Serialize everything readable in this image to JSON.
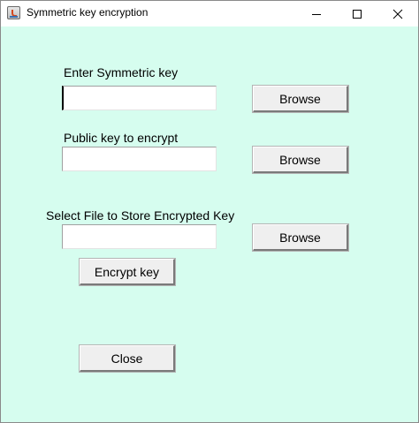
{
  "window": {
    "title": "Symmetric key encryption",
    "icon": "java-cup-icon"
  },
  "form": {
    "symmetric_key": {
      "label": "Enter Symmetric key",
      "value": "",
      "browse_label": "Browse"
    },
    "public_key": {
      "label": "Public key to encrypt",
      "value": "",
      "browse_label": "Browse"
    },
    "output_file": {
      "label": "Select File to Store Encrypted Key",
      "value": "",
      "browse_label": "Browse"
    },
    "encrypt_label": "Encrypt key",
    "close_label": "Close"
  },
  "colors": {
    "background": "#d6fdef",
    "titlebar": "#ffffff",
    "button_face": "#efefef"
  }
}
